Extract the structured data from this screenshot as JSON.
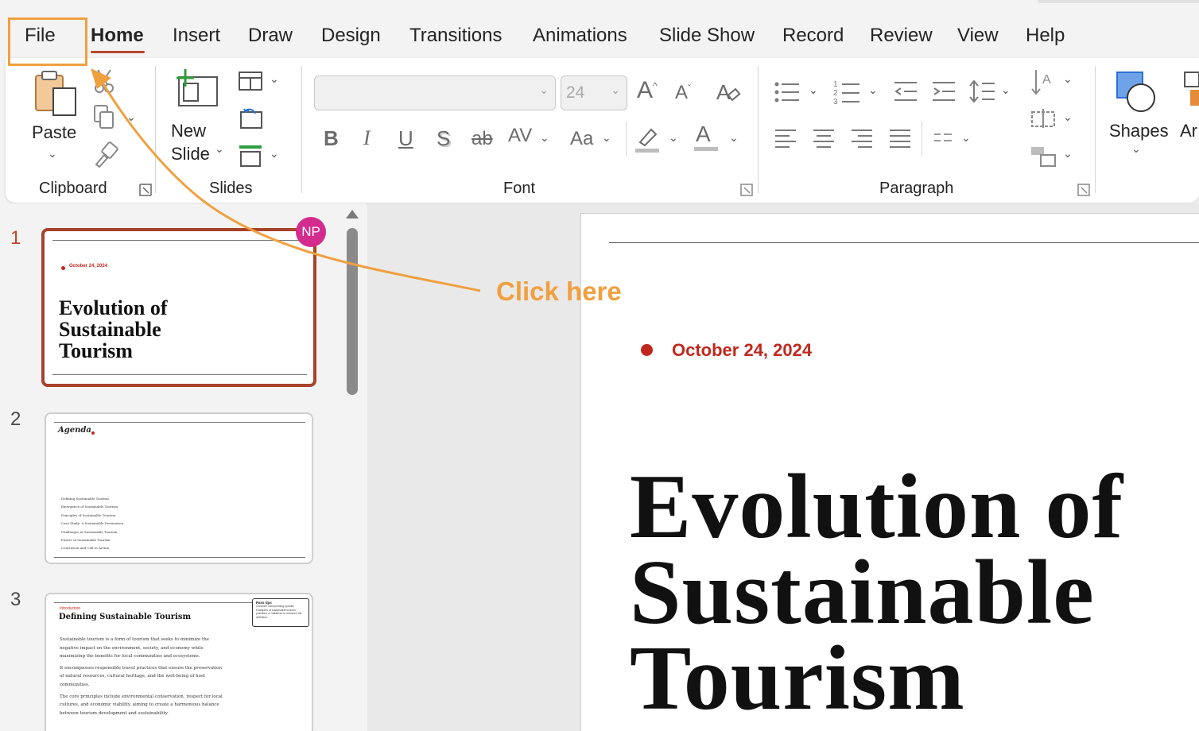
{
  "menu": {
    "tabs": [
      "File",
      "Home",
      "Insert",
      "Draw",
      "Design",
      "Transitions",
      "Animations",
      "Slide Show",
      "Record",
      "Review",
      "View",
      "Help"
    ],
    "active_tab": "Home"
  },
  "ribbon": {
    "clipboard": {
      "paste_label": "Paste",
      "group_label": "Clipboard"
    },
    "slides": {
      "new_slide_line1": "New",
      "new_slide_line2": "Slide",
      "group_label": "Slides"
    },
    "font": {
      "font_name_value": "",
      "font_size_value": "24",
      "group_label": "Font",
      "buttons": {
        "bold": "B",
        "italic": "I",
        "underline": "U",
        "shadow": "S",
        "strike": "ab",
        "spacing": "AV",
        "case": "Aa",
        "grow": "A",
        "shrink": "A",
        "font_color": "A"
      }
    },
    "paragraph": {
      "group_label": "Paragraph"
    },
    "drawing": {
      "shapes_label": "Shapes",
      "arrange_label": "Ar"
    }
  },
  "thumbnails": [
    {
      "number": "1",
      "date": "October 24, 2024",
      "title_lines": [
        "Evolution of",
        "Sustainable",
        "Tourism"
      ]
    },
    {
      "number": "2",
      "title": "Agenda",
      "items": [
        "Defining Sustainable Tourism",
        "Emergence of Sustainable Tourism",
        "Principles of Sustainable Tourism",
        "Case Study: A Sustainable Destination",
        "Challenges in Sustainable Tourism",
        "Future of Sustainable Tourism",
        "Conclusion and Call to Action"
      ]
    },
    {
      "number": "3",
      "kicker": "Introduction",
      "title": "Defining Sustainable Tourism",
      "note_title": "Pass tips",
      "note_text": "Consider incorporating specific examples of sustainable tourism practices or initiatives to enhance the definition.",
      "paragraphs": [
        "Sustainable tourism is a form of tourism that seeks to minimize the negative impact on the environment, society, and economy while maximizing the benefits for local communities and ecosystems.",
        "It encompasses responsible travel practices that ensure the preservation of natural resources, cultural heritage, and the well-being of host communities.",
        "The core principles include environmental conservation, respect for local cultures, and economic viability, aiming to create a harmonious balance between tourism development and sustainability."
      ]
    }
  ],
  "presence": {
    "initials": "NP",
    "color": "#d42b8f"
  },
  "main_slide": {
    "date": "October 24, 2024",
    "title_lines": [
      "Evolution of",
      "Sustainable",
      "Tourism"
    ]
  },
  "annotation": {
    "callout_text": "Click here",
    "color": "#f0a040"
  },
  "colors": {
    "accent": "#b7472a",
    "date_red": "#c0281e"
  }
}
